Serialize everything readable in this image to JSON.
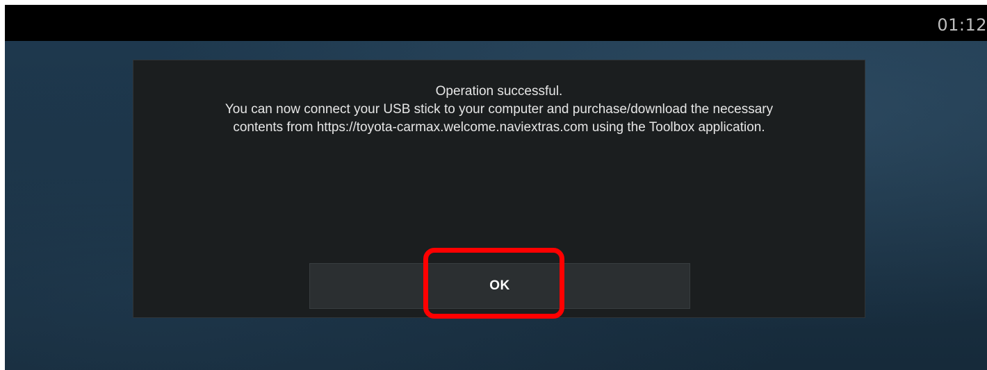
{
  "status_bar": {
    "clock": "01:12"
  },
  "dialog": {
    "message_lines": [
      "Operation successful.",
      "You can now connect your USB stick to your computer and purchase/download the necessary",
      "contents from https://toyota-carmax.welcome.naviextras.com using the Toolbox application."
    ],
    "ok_label": "OK"
  },
  "colors": {
    "status_bar": "#000000",
    "dialog_background": "#1b1e1f",
    "button_background": "#2b2f31",
    "highlight": "#ff0000"
  }
}
